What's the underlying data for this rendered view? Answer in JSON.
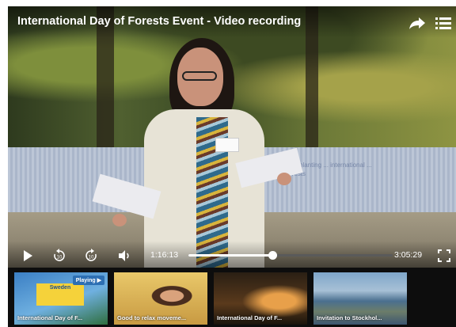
{
  "player": {
    "title": "International Day of Forests Event - Video recording",
    "current_time": "1:16:13",
    "duration": "3:05:29",
    "progress": 0.41,
    "banner_text": "tree planting ... international ... forests"
  },
  "icons": {
    "share": "share-icon",
    "menu": "playlist-menu-icon",
    "play": "play-icon",
    "rewind": "rewind-10-icon",
    "forward": "forward-10-icon",
    "volume": "volume-icon",
    "fullscreen": "fullscreen-icon"
  },
  "colors": {
    "accent": "#2d6fb3",
    "promo": "#f5d23a"
  },
  "thumbnails": [
    {
      "caption": "International Day of F...",
      "badge": "Playing ▶",
      "promo": "Sweden"
    },
    {
      "caption": "Good to relax moveme..."
    },
    {
      "caption": "International Day of F..."
    },
    {
      "caption": "Invitation to Stockhol..."
    }
  ]
}
